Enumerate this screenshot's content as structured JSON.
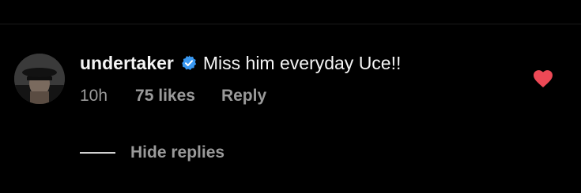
{
  "comment": {
    "username": "undertaker",
    "verified": true,
    "text": "Miss him everyday Uce!!",
    "time_ago": "10h",
    "likes": "75 likes",
    "reply_label": "Reply",
    "liked": true
  },
  "replies": {
    "toggle_label": "Hide replies"
  },
  "icons": {
    "verified": "verified-badge-icon",
    "like": "heart-icon"
  },
  "colors": {
    "background": "#000000",
    "primary_text": "#f5f5f5",
    "secondary_text": "#9a9a9a",
    "verified": "#3897f0",
    "heart": "#ed4956"
  }
}
